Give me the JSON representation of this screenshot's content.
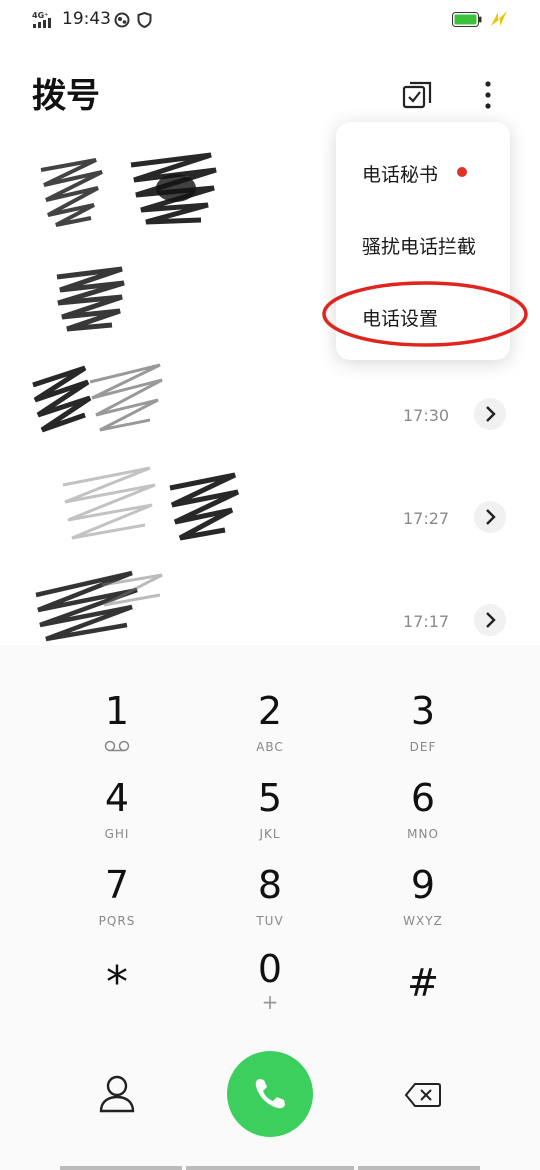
{
  "status_bar": {
    "signal": "4G⁺",
    "time": "19:43",
    "colors": {
      "battery": "#3cc13c",
      "charge": "#f2c300"
    }
  },
  "header": {
    "title": "拨号",
    "icons": [
      "multi-select-icon",
      "more-vertical-icon"
    ]
  },
  "menu": {
    "items": [
      "电话秘书",
      "骚扰电话拦截",
      "电话设置"
    ],
    "badge_color": "#e23227",
    "annotation_color": "#e02520"
  },
  "call_log": [
    {
      "time": ""
    },
    {
      "time": ""
    },
    {
      "time": "17:30"
    },
    {
      "time": "17:27"
    },
    {
      "time": "17:17"
    }
  ],
  "dialpad": {
    "keys": [
      {
        "digit": "1",
        "letters": ""
      },
      {
        "digit": "2",
        "letters": "ABC"
      },
      {
        "digit": "3",
        "letters": "DEF"
      },
      {
        "digit": "4",
        "letters": "GHI"
      },
      {
        "digit": "5",
        "letters": "JKL"
      },
      {
        "digit": "6",
        "letters": "MNO"
      },
      {
        "digit": "7",
        "letters": "PQRS"
      },
      {
        "digit": "8",
        "letters": "TUV"
      },
      {
        "digit": "9",
        "letters": "WXYZ"
      },
      {
        "digit": "*",
        "letters": ""
      },
      {
        "digit": "0",
        "letters": "+"
      },
      {
        "digit": "#",
        "letters": ""
      }
    ]
  },
  "bottom_bar": {
    "icons": [
      "contacts-icon",
      "phone-icon",
      "backspace-icon"
    ],
    "call_color": "#3ccf5e"
  }
}
